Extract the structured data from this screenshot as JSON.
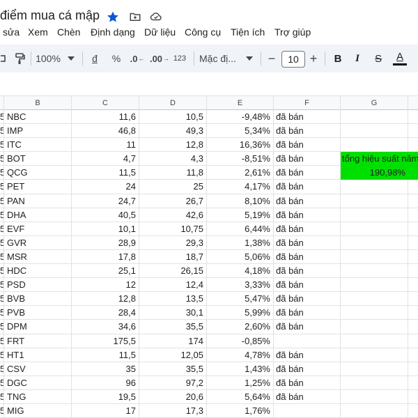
{
  "title": "điểm mua cá mập",
  "menu": [
    "sửa",
    "Xem",
    "Chèn",
    "Định dạng",
    "Dữ liệu",
    "Công cụ",
    "Tiện ích",
    "Trợ giúp"
  ],
  "toolbar": {
    "zoom": "100%",
    "currency": "đ",
    "percent": "%",
    "decrease_decimal": ".0",
    "increase_decimal": ".00",
    "number_format": "123",
    "font": "Mặc đị...",
    "font_size": "10",
    "minus": "−",
    "plus": "+",
    "bold": "B",
    "italic": "I",
    "strike": "S",
    "text_color": "A"
  },
  "columns": [
    "B",
    "C",
    "D",
    "E",
    "F",
    "G"
  ],
  "row_prefix": "5",
  "rows": [
    {
      "b": "NBC",
      "c": "11,6",
      "d": "10,5",
      "e": "-9,48%",
      "f": "đã bán"
    },
    {
      "b": "IMP",
      "c": "46,8",
      "d": "49,3",
      "e": "5,34%",
      "f": "đã bán"
    },
    {
      "b": "ITC",
      "c": "11",
      "d": "12,8",
      "e": "16,36%",
      "f": "đã bán"
    },
    {
      "b": "BOT",
      "c": "4,7",
      "d": "4,3",
      "e": "-8,51%",
      "f": "đã bán"
    },
    {
      "b": "QCG",
      "c": "11,5",
      "d": "11,8",
      "e": "2,61%",
      "f": "đã bán"
    },
    {
      "b": "PET",
      "c": "24",
      "d": "25",
      "e": "4,17%",
      "f": "đã bán"
    },
    {
      "b": "PAN",
      "c": "24,7",
      "d": "26,7",
      "e": "8,10%",
      "f": "đã bán"
    },
    {
      "b": "DHA",
      "c": "40,5",
      "d": "42,6",
      "e": "5,19%",
      "f": "đã bán"
    },
    {
      "b": "EVF",
      "c": "10,1",
      "d": "10,75",
      "e": "6,44%",
      "f": "đã bán"
    },
    {
      "b": "GVR",
      "c": "28,9",
      "d": "29,3",
      "e": "1,38%",
      "f": "đã bán"
    },
    {
      "b": "MSR",
      "c": "17,8",
      "d": "18,7",
      "e": "5,06%",
      "f": "đã bán"
    },
    {
      "b": "HDC",
      "c": "25,1",
      "d": "26,15",
      "e": "4,18%",
      "f": "đã bán"
    },
    {
      "b": "PSD",
      "c": "12",
      "d": "12,4",
      "e": "3,33%",
      "f": "đã bán"
    },
    {
      "b": "BVB",
      "c": "12,8",
      "d": "13,5",
      "e": "5,47%",
      "f": "đã bán"
    },
    {
      "b": "PVB",
      "c": "28,4",
      "d": "30,1",
      "e": "5,99%",
      "f": "đã bán"
    },
    {
      "b": "DPM",
      "c": "34,6",
      "d": "35,5",
      "e": "2,60%",
      "f": "đã bán"
    },
    {
      "b": "FRT",
      "c": "175,5",
      "d": "174",
      "e": "-0,85%",
      "f": ""
    },
    {
      "b": "HT1",
      "c": "11,5",
      "d": "12,05",
      "e": "4,78%",
      "f": "đã bán"
    },
    {
      "b": "CSV",
      "c": "35",
      "d": "35,5",
      "e": "1,43%",
      "f": "đã bán"
    },
    {
      "b": "DGC",
      "c": "96",
      "d": "97,2",
      "e": "1,25%",
      "f": "đã bán"
    },
    {
      "b": "TNG",
      "c": "19,5",
      "d": "20,6",
      "e": "5,64%",
      "f": "đã bán"
    },
    {
      "b": "MIG",
      "c": "17",
      "d": "17,3",
      "e": "1,76%",
      "f": ""
    }
  ],
  "summary": {
    "label": "tổng hiệu suất năm",
    "value": "190,98%",
    "color": "#00e000"
  },
  "icons": {
    "star": "star-icon",
    "folder": "move-folder-icon",
    "cloud": "cloud-saved-icon"
  },
  "colors": {
    "star": "#0b57d0",
    "toolbar_bg": "#f0f4f9",
    "summary_bg": "#00e000"
  }
}
